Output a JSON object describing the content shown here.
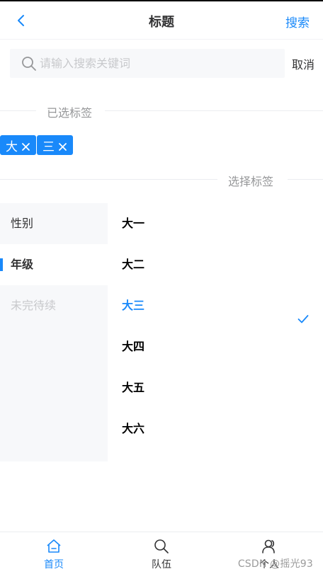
{
  "navbar": {
    "title": "标题",
    "right": "搜索"
  },
  "search": {
    "placeholder": "请输入搜索关键词",
    "value": "",
    "cancel": "取消"
  },
  "selected_divider": "已选标签",
  "selected_tags": [
    "大",
    "三"
  ],
  "choose_divider": "选择标签",
  "tree": {
    "nav": [
      {
        "label": "性别",
        "state": "normal"
      },
      {
        "label": "年级",
        "state": "active"
      },
      {
        "label": "未完待续",
        "state": "disabled"
      }
    ],
    "options": [
      {
        "label": "大一",
        "selected": false
      },
      {
        "label": "大二",
        "selected": false
      },
      {
        "label": "大三",
        "selected": true
      },
      {
        "label": "大四",
        "selected": false
      },
      {
        "label": "大五",
        "selected": false
      },
      {
        "label": "大六",
        "selected": false
      }
    ]
  },
  "tabbar": [
    {
      "label": "首页",
      "icon": "home-icon",
      "active": true
    },
    {
      "label": "队伍",
      "icon": "search-icon",
      "active": false
    },
    {
      "label": "个人",
      "icon": "user-icon",
      "active": false
    }
  ],
  "watermark": "CSDN @摇光93",
  "colors": {
    "accent": "#1989fa",
    "text": "#323233",
    "muted": "#969799",
    "disabled": "#c8c9cc",
    "panel": "#f7f8fa"
  }
}
